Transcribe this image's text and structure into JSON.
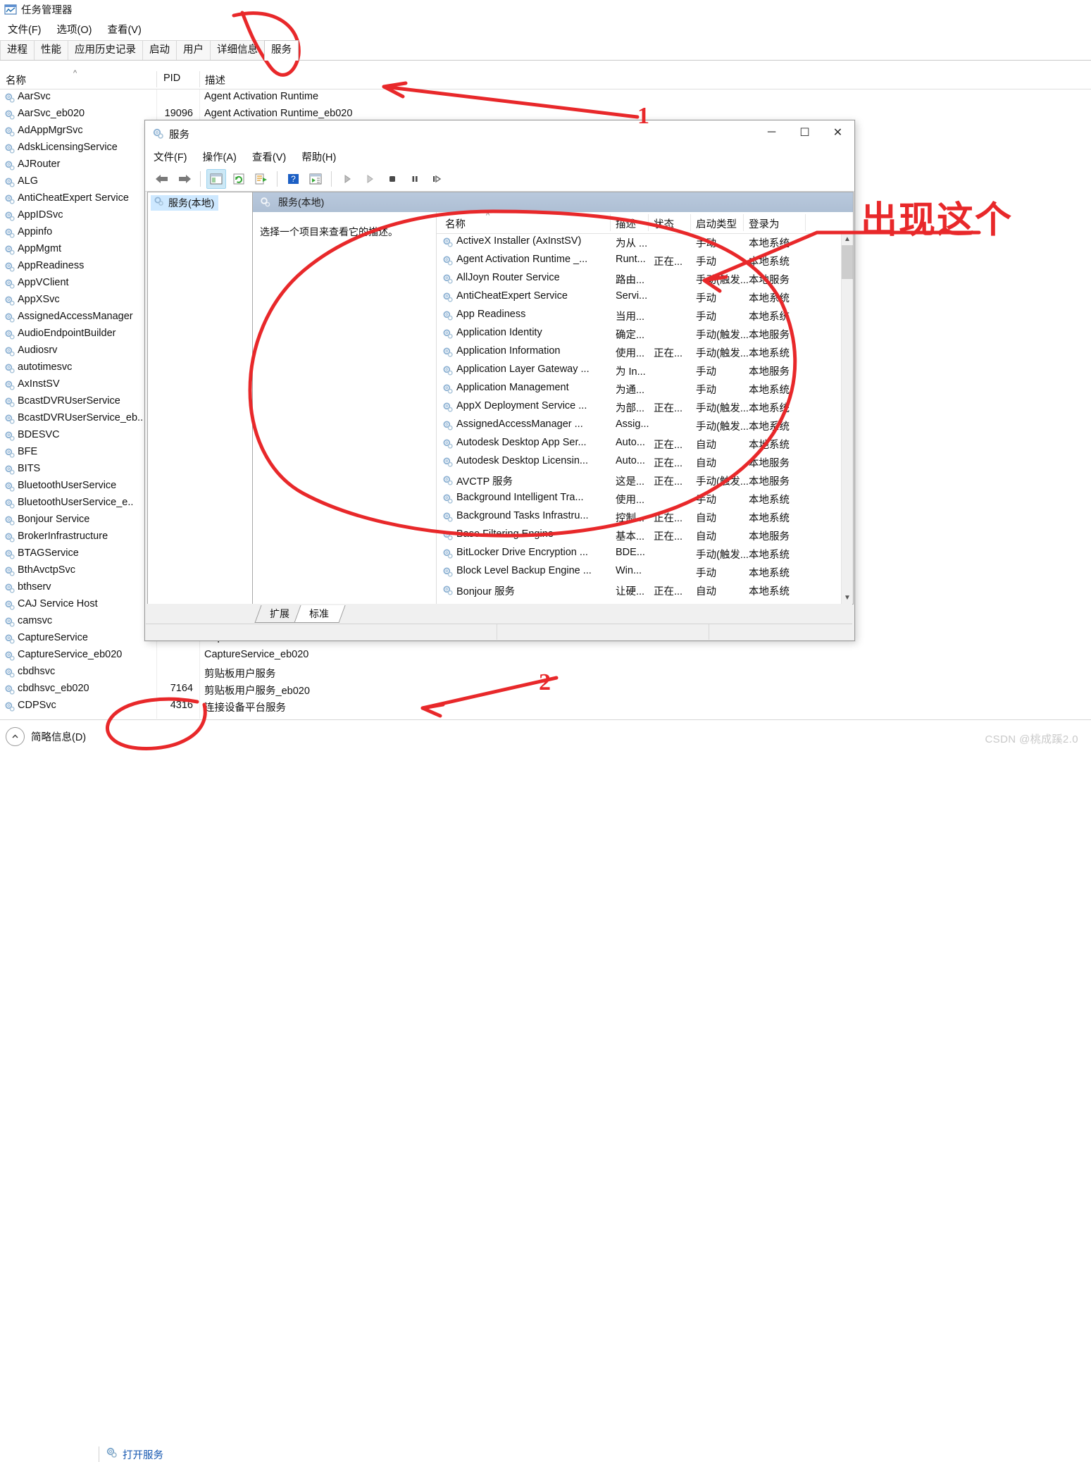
{
  "taskmanager": {
    "window_title": "任务管理器",
    "title_icon": "task-manager-icon",
    "menu": [
      "文件(F)",
      "选项(O)",
      "查看(V)"
    ],
    "tabs": [
      {
        "label": "进程",
        "active": false
      },
      {
        "label": "性能",
        "active": false
      },
      {
        "label": "应用历史记录",
        "active": false
      },
      {
        "label": "启动",
        "active": false
      },
      {
        "label": "用户",
        "active": false
      },
      {
        "label": "详细信息",
        "active": false
      },
      {
        "label": "服务",
        "active": true
      }
    ],
    "columns": [
      "名称",
      "PID",
      "描述"
    ],
    "sort_indicator": "^",
    "rows": [
      {
        "name": "AarSvc",
        "pid": "",
        "desc": "Agent Activation Runtime"
      },
      {
        "name": "AarSvc_eb020",
        "pid": "19096",
        "desc": "Agent Activation Runtime_eb020"
      },
      {
        "name": "AdAppMgrSvc",
        "pid": "",
        "desc": ""
      },
      {
        "name": "AdskLicensingService",
        "pid": "",
        "desc": ""
      },
      {
        "name": "AJRouter",
        "pid": "",
        "desc": ""
      },
      {
        "name": "ALG",
        "pid": "",
        "desc": ""
      },
      {
        "name": "AntiCheatExpert Service",
        "pid": "",
        "desc": ""
      },
      {
        "name": "AppIDSvc",
        "pid": "",
        "desc": ""
      },
      {
        "name": "Appinfo",
        "pid": "",
        "desc": ""
      },
      {
        "name": "AppMgmt",
        "pid": "",
        "desc": ""
      },
      {
        "name": "AppReadiness",
        "pid": "",
        "desc": ""
      },
      {
        "name": "AppVClient",
        "pid": "",
        "desc": ""
      },
      {
        "name": "AppXSvc",
        "pid": "",
        "desc": ""
      },
      {
        "name": "AssignedAccessManager",
        "pid": "",
        "desc": ""
      },
      {
        "name": "AudioEndpointBuilder",
        "pid": "",
        "desc": ""
      },
      {
        "name": "Audiosrv",
        "pid": "",
        "desc": ""
      },
      {
        "name": "autotimesvc",
        "pid": "",
        "desc": ""
      },
      {
        "name": "AxInstSV",
        "pid": "",
        "desc": ""
      },
      {
        "name": "BcastDVRUserService",
        "pid": "",
        "desc": ""
      },
      {
        "name": "BcastDVRUserService_eb..",
        "pid": "",
        "desc": ""
      },
      {
        "name": "BDESVC",
        "pid": "",
        "desc": ""
      },
      {
        "name": "BFE",
        "pid": "",
        "desc": ""
      },
      {
        "name": "BITS",
        "pid": "",
        "desc": ""
      },
      {
        "name": "BluetoothUserService",
        "pid": "",
        "desc": ""
      },
      {
        "name": "BluetoothUserService_e..",
        "pid": "",
        "desc": ""
      },
      {
        "name": "Bonjour Service",
        "pid": "",
        "desc": ""
      },
      {
        "name": "BrokerInfrastructure",
        "pid": "",
        "desc": ""
      },
      {
        "name": "BTAGService",
        "pid": "",
        "desc": ""
      },
      {
        "name": "BthAvctpSvc",
        "pid": "",
        "desc": ""
      },
      {
        "name": "bthserv",
        "pid": "",
        "desc": ""
      },
      {
        "name": "CAJ Service Host",
        "pid": "",
        "desc": ""
      },
      {
        "name": "camsvc",
        "pid": "",
        "desc": ""
      },
      {
        "name": "CaptureService",
        "pid": "",
        "desc": "CaptureService"
      },
      {
        "name": "CaptureService_eb020",
        "pid": "",
        "desc": "CaptureService_eb020"
      },
      {
        "name": "cbdhsvc",
        "pid": "",
        "desc": "剪贴板用户服务"
      },
      {
        "name": "cbdhsvc_eb020",
        "pid": "7164",
        "desc": "剪贴板用户服务_eb020"
      },
      {
        "name": "CDPSvc",
        "pid": "4316",
        "desc": "连接设备平台服务"
      }
    ],
    "statusbar": {
      "brief_label": "简略信息(D)",
      "brief_icon": "chevron-up-circle-icon",
      "open_services_label": "打开服务",
      "open_services_icon": "services-gear-icon"
    }
  },
  "services_window": {
    "window_title": "服务",
    "title_icon": "services-gear-icon",
    "window_buttons": {
      "minimize": "─",
      "maximize": "☐",
      "close": "✕"
    },
    "menu": [
      "文件(F)",
      "操作(A)",
      "查看(V)",
      "帮助(H)"
    ],
    "toolbar_icons": [
      "back-arrow-icon",
      "forward-arrow-icon",
      "show-hide-console-tree-icon",
      "refresh-icon",
      "export-list-icon",
      "help-icon",
      "show-hide-action-pane-icon",
      "start-service-icon",
      "resume-service-icon",
      "stop-service-icon",
      "pause-service-icon",
      "restart-service-icon"
    ],
    "tree": {
      "root_label": "服务(本地)",
      "icon": "services-gear-icon"
    },
    "pane_header": "服务(本地)",
    "description_placeholder": "选择一个项目来查看它的描述。",
    "columns": [
      "名称",
      "描述",
      "状态",
      "启动类型",
      "登录为"
    ],
    "sort_indicator": "^",
    "rows": [
      {
        "name": "ActiveX Installer (AxInstSV)",
        "desc": "为从 ...",
        "status": "",
        "startup": "手动",
        "logon": "本地系统"
      },
      {
        "name": "Agent Activation Runtime _...",
        "desc": "Runt...",
        "status": "正在...",
        "startup": "手动",
        "logon": "本地系统"
      },
      {
        "name": "AllJoyn Router Service",
        "desc": "路由...",
        "status": "",
        "startup": "手动(触发...",
        "logon": "本地服务"
      },
      {
        "name": "AntiCheatExpert Service",
        "desc": "Servi...",
        "status": "",
        "startup": "手动",
        "logon": "本地系统"
      },
      {
        "name": "App Readiness",
        "desc": "当用...",
        "status": "",
        "startup": "手动",
        "logon": "本地系统"
      },
      {
        "name": "Application Identity",
        "desc": "确定...",
        "status": "",
        "startup": "手动(触发...",
        "logon": "本地服务"
      },
      {
        "name": "Application Information",
        "desc": "使用...",
        "status": "正在...",
        "startup": "手动(触发...",
        "logon": "本地系统"
      },
      {
        "name": "Application Layer Gateway ...",
        "desc": "为 In...",
        "status": "",
        "startup": "手动",
        "logon": "本地服务"
      },
      {
        "name": "Application Management",
        "desc": "为通...",
        "status": "",
        "startup": "手动",
        "logon": "本地系统"
      },
      {
        "name": "AppX Deployment Service ...",
        "desc": "为部...",
        "status": "正在...",
        "startup": "手动(触发...",
        "logon": "本地系统"
      },
      {
        "name": "AssignedAccessManager ...",
        "desc": "Assig...",
        "status": "",
        "startup": "手动(触发...",
        "logon": "本地系统"
      },
      {
        "name": "Autodesk Desktop App Ser...",
        "desc": "Auto...",
        "status": "正在...",
        "startup": "自动",
        "logon": "本地系统"
      },
      {
        "name": "Autodesk Desktop Licensin...",
        "desc": "Auto...",
        "status": "正在...",
        "startup": "自动",
        "logon": "本地服务"
      },
      {
        "name": "AVCTP 服务",
        "desc": "这是...",
        "status": "正在...",
        "startup": "手动(触发...",
        "logon": "本地服务"
      },
      {
        "name": "Background Intelligent Tra...",
        "desc": "使用...",
        "status": "",
        "startup": "手动",
        "logon": "本地系统"
      },
      {
        "name": "Background Tasks Infrastru...",
        "desc": "控制...",
        "status": "正在...",
        "startup": "自动",
        "logon": "本地系统"
      },
      {
        "name": "Base Filtering Engine",
        "desc": "基本...",
        "status": "正在...",
        "startup": "自动",
        "logon": "本地服务"
      },
      {
        "name": "BitLocker Drive Encryption ...",
        "desc": "BDE...",
        "status": "",
        "startup": "手动(触发...",
        "logon": "本地系统"
      },
      {
        "name": "Block Level Backup Engine ...",
        "desc": "Win...",
        "status": "",
        "startup": "手动",
        "logon": "本地系统"
      },
      {
        "name": "Bonjour 服务",
        "desc": "让硬...",
        "status": "正在...",
        "startup": "自动",
        "logon": "本地系统"
      }
    ],
    "bottom_tabs": [
      {
        "label": "扩展",
        "active": false
      },
      {
        "label": "标准",
        "active": true
      }
    ]
  },
  "annotations": [
    {
      "id": "marker-1",
      "text": "1",
      "kind": "number"
    },
    {
      "id": "marker-2",
      "text": "2",
      "kind": "number"
    },
    {
      "id": "marker-note",
      "text": "出现这个",
      "kind": "note"
    }
  ],
  "watermark": {
    "text": "CSDN @桃成蹊2.0"
  },
  "colors": {
    "annotation_red": "#e8282a",
    "link_blue": "#1557b0",
    "selection_blue": "#cde8ff",
    "pane_header": "#b4c5da"
  }
}
